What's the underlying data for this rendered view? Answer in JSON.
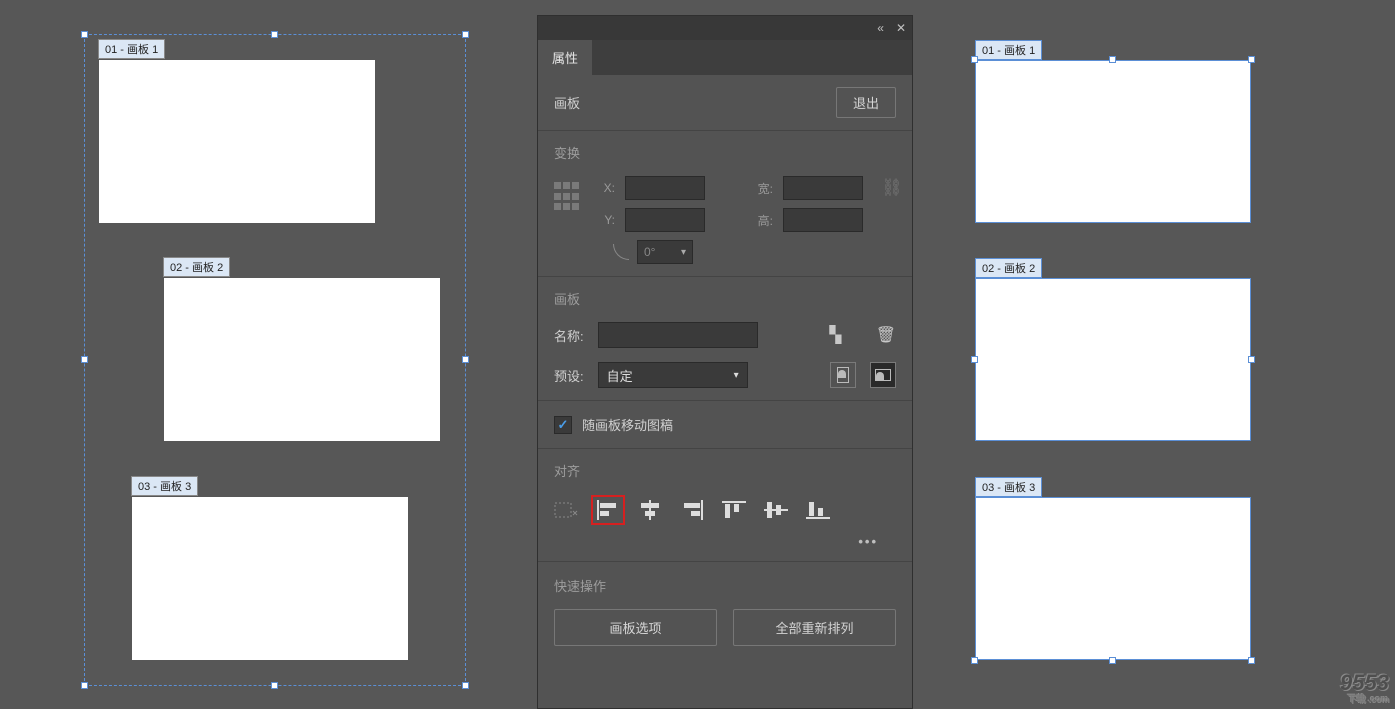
{
  "artboards": {
    "left": [
      {
        "label": "01 - 画板 1"
      },
      {
        "label": "02 - 画板 2"
      },
      {
        "label": "03 - 画板 3"
      }
    ],
    "right": [
      {
        "label": "01 - 画板 1"
      },
      {
        "label": "02 - 画板 2"
      },
      {
        "label": "03 - 画板 3"
      }
    ]
  },
  "panel": {
    "tab": "属性",
    "artboard_label": "画板",
    "exit": "退出",
    "transform": {
      "title": "变换",
      "x_label": "X:",
      "y_label": "Y:",
      "w_label": "宽:",
      "h_label": "高:",
      "angle_value": "0°"
    },
    "artboard_section": {
      "title": "画板",
      "name_label": "名称:",
      "preset_label": "预设:",
      "preset_value": "自定"
    },
    "move_with_artboard": "随画板移动图稿",
    "align": {
      "title": "对齐"
    },
    "quick": {
      "title": "快速操作",
      "artboard_options": "画板选项",
      "rearrange_all": "全部重新排列"
    }
  },
  "watermark": {
    "main": "9553",
    "sub": "下载 .com"
  }
}
